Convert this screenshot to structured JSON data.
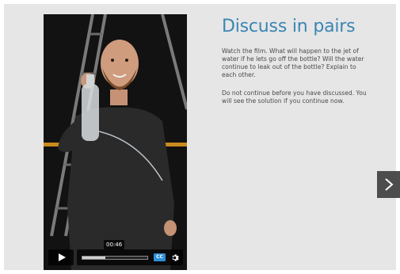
{
  "slide": {
    "title": "Discuss in pairs",
    "paragraphs": [
      "Watch the film. What will happen to the jet of water if he lets go off the bottle? Will the water continue to leak out of the bottle? Explain to each other.",
      "Do not continue before you have discussed. You will see the solution if you continue now."
    ]
  },
  "video": {
    "current_time": "00:46",
    "progress_fraction": 0.35,
    "cc_label": "CC",
    "icons": {
      "play": "play-icon",
      "settings": "gear-icon",
      "captions": "cc-icon"
    }
  },
  "navigation": {
    "next_icon": "chevron-right-icon"
  },
  "colors": {
    "background": "#e6e6e6",
    "title": "#3a86b4",
    "body_text": "#4a4a4a",
    "next_button": "#4d4d4d",
    "cc_accent": "#2e8fd8"
  }
}
